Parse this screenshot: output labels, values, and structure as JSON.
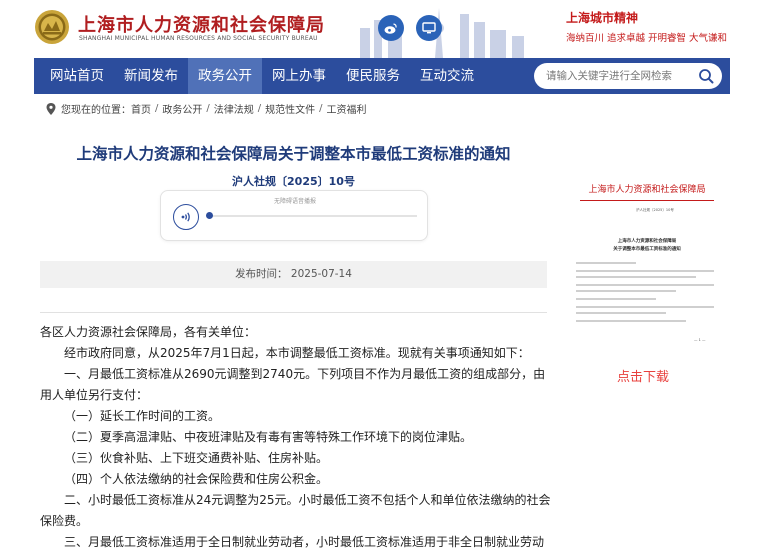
{
  "header": {
    "site_title": "上海市人力资源和社会保障局",
    "site_subtitle": "SHANGHAI MUNICIPAL HUMAN RESOURCES AND SOCIAL SECURITY BUREAU",
    "spirit_title": "上海城市精神",
    "spirit_slogan": "海纳百川 追求卓越 开明睿智 大气谦和",
    "icons": [
      "weibo-icon",
      "monitor-icon"
    ]
  },
  "nav": {
    "items": [
      "网站首页",
      "新闻发布",
      "政务公开",
      "网上办事",
      "便民服务",
      "互动交流"
    ],
    "active_index": 2,
    "search_placeholder": "请输入关键字进行全网检索"
  },
  "breadcrumb": {
    "label": "您现在的位置：",
    "items": [
      "首页",
      "政务公开",
      "法律法规",
      "规范性文件",
      "工资福利"
    ]
  },
  "article": {
    "title": "上海市人力资源和社会保障局关于调整本市最低工资标准的通知",
    "doc_number": "沪人社规〔2025〕10号",
    "audio_hint": "无障碍语音播报",
    "publish": "发布时间：  2025-07-14",
    "paragraphs": [
      "各区人力资源社会保障局，各有关单位：",
      "经市政府同意，从2025年7月1日起，本市调整最低工资标准。现就有关事项通知如下：",
      "一、月最低工资标准从2690元调整到2740元。下列项目不作为月最低工资的组成部分，由用人单位另行支付：",
      "（一）延长工作时间的工资。",
      "（二）夏季高温津贴、中夜班津贴及有毒有害等特殊工作环境下的岗位津贴。",
      "（三）伙食补贴、上下班交通费补贴、住房补贴。",
      "（四）个人依法缴纳的社会保险费和住房公积金。",
      "二、小时最低工资标准从24元调整为25元。小时最低工资不包括个人和单位依法缴纳的社会保险费。",
      "三、月最低工资标准适用于全日制就业劳动者，小时最低工资标准适用于非全日制就业劳动者。"
    ]
  },
  "sidebar": {
    "doc_header": "上海市人力资源和社会保障局",
    "doc_title_line1": "上海市人力资源和社会保障局",
    "doc_title_line2": "关于调整本市最低工资标准的通知",
    "download_label": "点击下载"
  },
  "colors": {
    "nav_bg": "#2c4d9d",
    "nav_active": "#5071b8",
    "brand_red": "#b01e20",
    "title_blue": "#1f3b7a",
    "download_red": "#e8413e"
  }
}
